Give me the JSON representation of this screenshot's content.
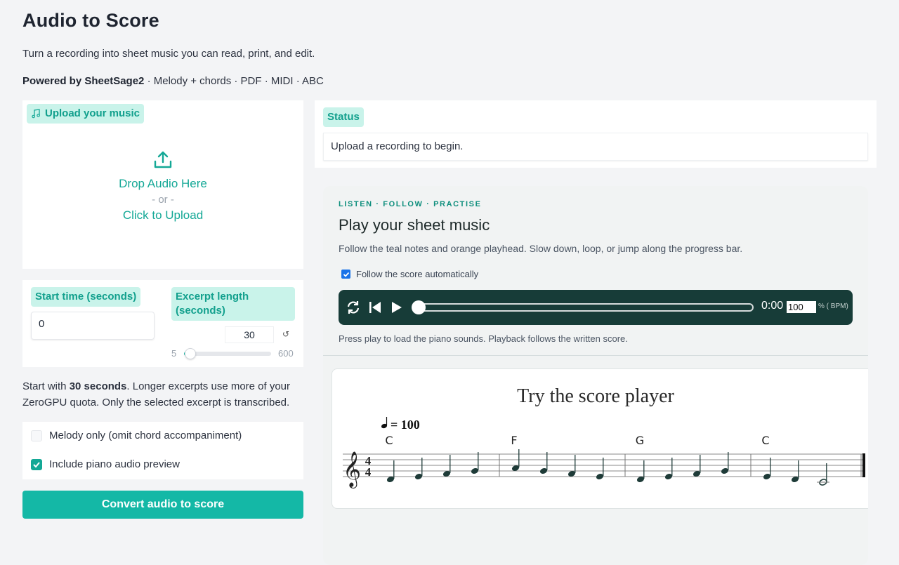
{
  "header": {
    "title": "Audio to Score",
    "subtitle": "Turn a recording into sheet music you can read, print, and edit.",
    "powered_prefix": "Powered by SheetSage2",
    "powered_rest": " · Melody + chords · PDF · MIDI · ABC"
  },
  "upload": {
    "label": "Upload your music",
    "icon": "music-note-icon",
    "drop_text": "Drop Audio Here",
    "or_text": "- or -",
    "click_text": "Click to Upload"
  },
  "start_time": {
    "label": "Start time (seconds)",
    "value": "0"
  },
  "excerpt": {
    "label": "Excerpt length (seconds)",
    "value": "30",
    "min": "5",
    "max": "600",
    "fraction": 0.042
  },
  "hint": {
    "prefix": "Start with ",
    "bold": "30 seconds",
    "suffix": ". Longer excerpts use more of your ZeroGPU quota. Only the selected excerpt is transcribed."
  },
  "options": [
    {
      "label": "Melody only (omit chord accompaniment)",
      "checked": false
    },
    {
      "label": "Include piano audio preview",
      "checked": true
    }
  ],
  "convert_label": "Convert audio to score",
  "status": {
    "label": "Status",
    "message": "Upload a recording to begin."
  },
  "player": {
    "eyebrow": "LISTEN · FOLLOW · PRACTISE",
    "title": "Play your sheet music",
    "description": "Follow the teal notes and orange playhead. Slow down, loop, or jump along the progress bar.",
    "follow_label": "Follow the score automatically",
    "time": "0:00",
    "bpm": "100",
    "bpm_unit": "% ( BPM)",
    "note": "Press play to load the piano sounds. Playback follows the written score.",
    "progress": 0
  },
  "score": {
    "title": "Try the score player",
    "tempo": "= 100",
    "time_signature": [
      "4",
      "4"
    ],
    "chords": [
      "C",
      "F",
      "G",
      "C"
    ]
  },
  "colors": {
    "accent": "#14b8a6",
    "accent_text": "#14a896",
    "chip_bg": "#c9f3ea",
    "transport_bg": "#173c38"
  }
}
